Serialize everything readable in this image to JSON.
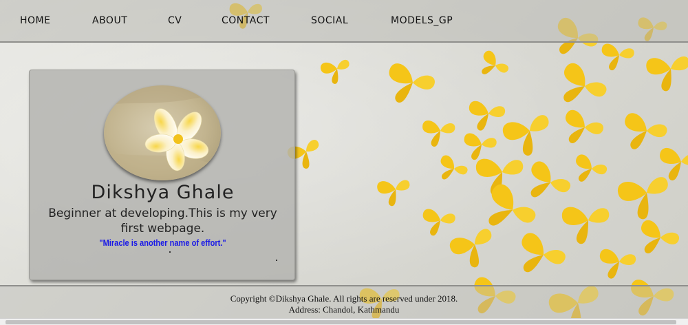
{
  "nav": {
    "items": [
      {
        "label": "HOME"
      },
      {
        "label": "ABOUT"
      },
      {
        "label": "CV"
      },
      {
        "label": "CONTACT"
      },
      {
        "label": "SOCIAL"
      },
      {
        "label": "MODELS_GP"
      }
    ]
  },
  "profile": {
    "name": "Dikshya Ghale",
    "bio": "Beginner at developing.This is my very first webpage.",
    "quote": "\"Miracle is another name of effort.\""
  },
  "footer": {
    "copyright": "Copyright ©Dikshya Ghale. All rights are reserved under 2018.",
    "address": "Address: Chandol, Kathmandu"
  },
  "colors": {
    "butterfly": "#f5c518",
    "quote": "#1a1ae6"
  }
}
